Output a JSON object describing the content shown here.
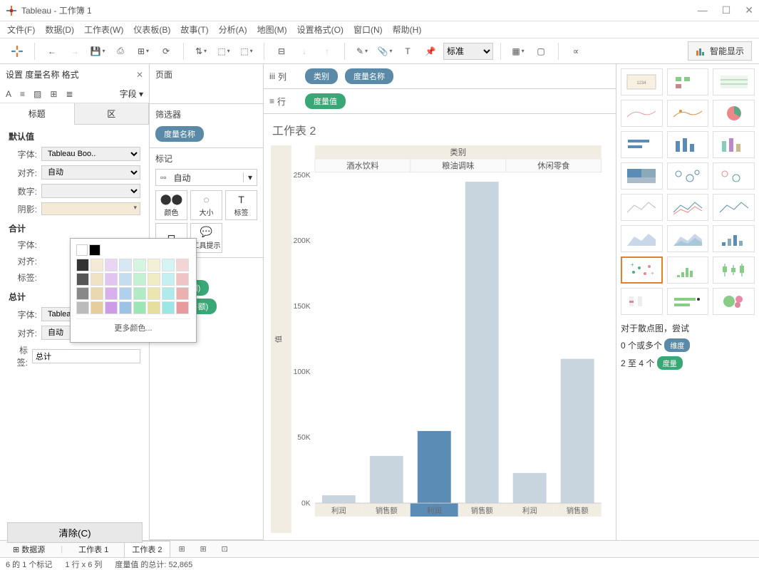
{
  "window": {
    "title": "Tableau - 工作簿 1"
  },
  "menus": [
    "文件(F)",
    "数据(D)",
    "工作表(W)",
    "仪表板(B)",
    "故事(T)",
    "分析(A)",
    "地图(M)",
    "设置格式(O)",
    "窗口(N)",
    "帮助(H)"
  ],
  "toolbar": {
    "standard": "标准",
    "smart_show": "智能显示"
  },
  "format_panel": {
    "header": "设置 度量名称 格式",
    "field_link": "字段 ▾",
    "tabs": {
      "title": "标题",
      "zone": "区"
    },
    "defaults_label": "默认值",
    "total_label": "合计",
    "grand_total_label": "总计",
    "labels": {
      "font": "字体:",
      "align": "对齐:",
      "number": "数字:",
      "shadow": "阴影:",
      "label": "标签:"
    },
    "font_value": "Tableau Boo..",
    "align_value": "自动",
    "total_input": "总计",
    "clear": "清除(C)",
    "more_colors": "更多颜色..."
  },
  "mid": {
    "pages": "页面",
    "filters": "筛选器",
    "filter_pill": "度量名称",
    "marks": "标记",
    "marks_type": "自动",
    "marks_cells": {
      "color": "颜色",
      "size": "大小",
      "label": "标签",
      "detail": "详细信息",
      "tooltip": "工具提示"
    },
    "measure_values": "度量值",
    "mv_pills": [
      "总计(利润)",
      "总计(销售额)"
    ]
  },
  "shelves": {
    "columns_label": "列",
    "rows_label": "行",
    "col_pills": [
      "类别",
      "度量名称"
    ],
    "row_pills": [
      "度量值"
    ]
  },
  "viz": {
    "title": "工作表 2",
    "y_label": "值",
    "header": "类别"
  },
  "chart_data": {
    "type": "bar",
    "header": "类别",
    "categories": [
      "酒水饮料",
      "粮油调味",
      "休闲零食"
    ],
    "subcategories": [
      "利润",
      "销售额"
    ],
    "series": [
      {
        "name": "酒水饮料",
        "values": [
          6000,
          36000
        ]
      },
      {
        "name": "粮油调味",
        "values": [
          55000,
          245000
        ]
      },
      {
        "name": "休闲零食",
        "values": [
          23000,
          110000
        ]
      }
    ],
    "highlight": {
      "category_index": 1,
      "sub_index": 0
    },
    "ylim": [
      0,
      250000
    ],
    "yticks": [
      0,
      50000,
      100000,
      150000,
      200000,
      250000
    ],
    "ytick_labels": [
      "0K",
      "50K",
      "100K",
      "150K",
      "200K",
      "250K"
    ]
  },
  "showme": {
    "tip_title": "对于散点图，尝试",
    "tip1_prefix": "0 个或多个",
    "tip1_badge": "维度",
    "tip2_prefix": "2 至 4 个",
    "tip2_badge": "度量"
  },
  "bottom_tabs": {
    "datasource": "数据源",
    "sheet1": "工作表 1",
    "sheet2": "工作表 2"
  },
  "statusbar": {
    "marks": "6 的 1 个标记",
    "rowscols": "1 行 x 6 列",
    "sum": "度量值 的总计: 52,865"
  }
}
